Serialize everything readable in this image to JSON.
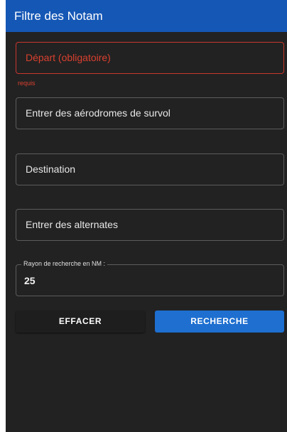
{
  "dialog": {
    "title": "Filtre des Notam"
  },
  "form": {
    "departure": {
      "placeholder": "Départ (obligatoire)",
      "helper": "requis"
    },
    "overflight": {
      "placeholder": "Entrer des aérodromes de survol"
    },
    "destination": {
      "placeholder": "Destination"
    },
    "alternates": {
      "placeholder": "Entrer des alternates"
    },
    "radius": {
      "label": "Rayon de recherche en NM :",
      "value": "25"
    }
  },
  "actions": {
    "clear_label": "EFFACER",
    "search_label": "RECHERCHE"
  },
  "colors": {
    "header": "#1557b5",
    "error": "#d9402f",
    "primary": "#1e6fd0",
    "background": "#222222"
  }
}
